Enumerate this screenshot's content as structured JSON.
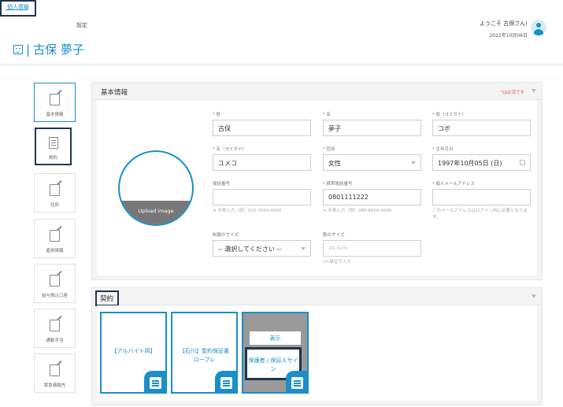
{
  "header": {
    "tabs": [
      {
        "label": "個人情報",
        "active": true
      },
      {
        "label": "設定",
        "active": false
      }
    ],
    "page_title": "古保 夢子",
    "welcome": "ようこそ 古保さん!",
    "date": "2022年10月06日",
    "icons": {
      "title": "face-icon",
      "avatar": "user-icon"
    }
  },
  "sidebar": {
    "items": [
      {
        "label": "基本情報",
        "icon": "edit-icon"
      },
      {
        "label": "契約",
        "icon": "document-icon"
      },
      {
        "label": "住所",
        "icon": "edit-icon"
      },
      {
        "label": "雇用情報",
        "icon": "edit-icon"
      },
      {
        "label": "給与振込口座",
        "icon": "edit-icon"
      },
      {
        "label": "通勤手当",
        "icon": "edit-icon"
      },
      {
        "label": "緊急連絡先",
        "icon": "edit-icon"
      }
    ]
  },
  "basic": {
    "title": "基本情報",
    "required_note": "*は必須です",
    "upload_label": "Upload image",
    "fields": {
      "sei": {
        "label": "姓",
        "value": "古保",
        "required": true
      },
      "mei": {
        "label": "名",
        "value": "夢子",
        "required": true
      },
      "sei_kana": {
        "label": "姓（ヨミガナ）",
        "value": "コボ",
        "required": true
      },
      "mei_kana": {
        "label": "名（ヨミガナ）",
        "value": "ユメコ",
        "required": true
      },
      "gender": {
        "label": "性別",
        "value": "女性",
        "required": true
      },
      "birthday": {
        "label": "生年月日",
        "value": "1997年10月05日 (日)",
        "required": true
      },
      "phone": {
        "label": "電話番号",
        "value": "",
        "required": false,
        "note": "※ 半角入力（例）030-3000-0000"
      },
      "mobile": {
        "label": "携帯電話番号",
        "value": "0801111222",
        "required": true,
        "note": "※ 半角入力（例）080-8000-0000"
      },
      "email": {
        "label": "個人メールアドレス",
        "value": "",
        "required": true,
        "note": "このメールアドレスはログイン時に必要となります。"
      },
      "uniform": {
        "label": "制服のサイズ",
        "value": "-- 選択してください --"
      },
      "shoe": {
        "label": "靴のサイズ",
        "placeholder": "24.5cm",
        "note": "cm単位で入力"
      }
    }
  },
  "contract": {
    "title": "契約",
    "cards": [
      {
        "title": "【アルバイト用】"
      },
      {
        "title": "【石川】誓約保証書ロープレ"
      },
      {
        "show_label": "表示",
        "sign_label": "保護者 / 保証人サイン"
      }
    ]
  },
  "colors": {
    "accent": "#1a8fc9",
    "highlight": "#1f3550",
    "required": "#e05c5c"
  }
}
